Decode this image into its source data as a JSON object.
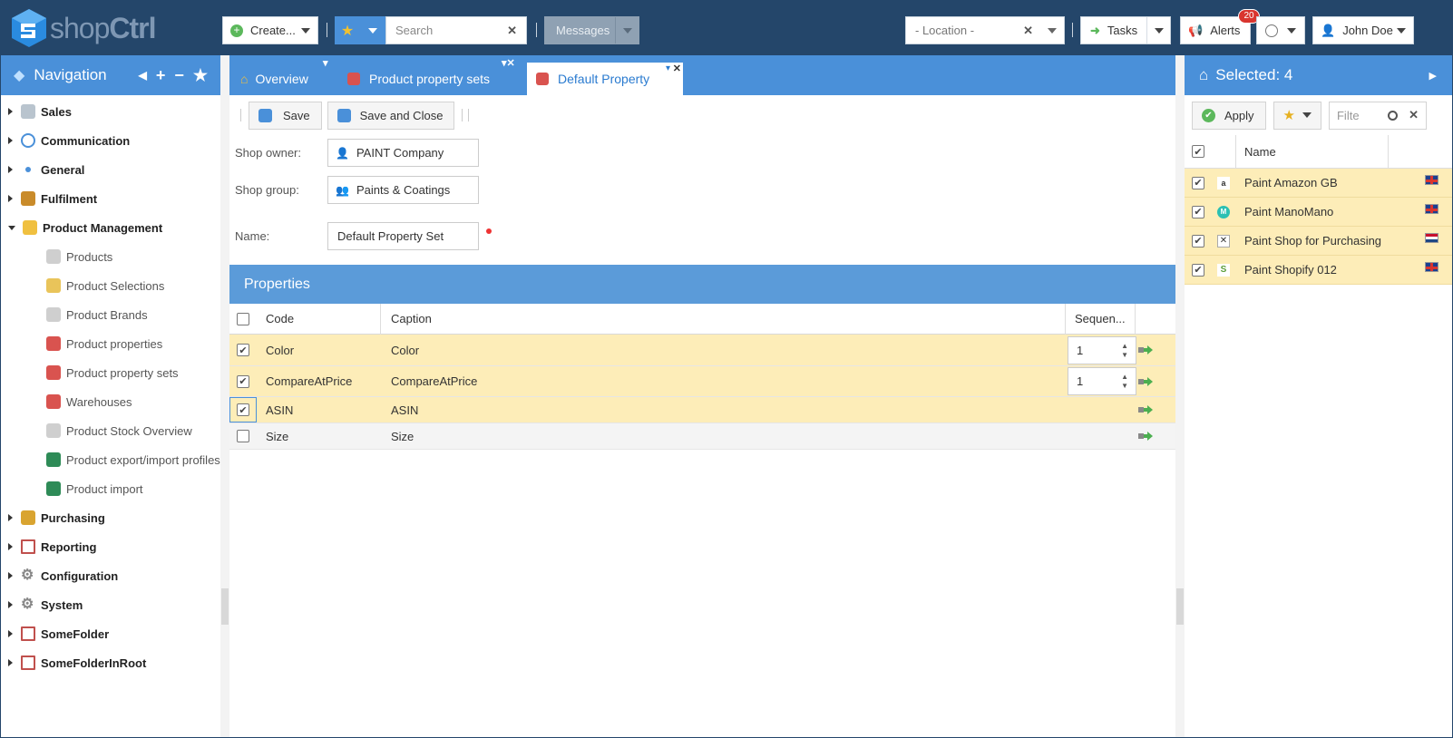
{
  "app": {
    "logo": "shopCtrl",
    "logo_prefix": "shop",
    "logo_suffix": "Ctrl"
  },
  "topbar": {
    "create_label": "Create...",
    "search_placeholder": "Search",
    "messages_label": "Messages",
    "location_placeholder": "- Location -",
    "tasks_label": "Tasks",
    "alerts_label": "Alerts",
    "alerts_count": "20",
    "user_name": "John Doe"
  },
  "nav": {
    "title": "Navigation",
    "items": [
      {
        "label": "Sales",
        "icon": "basket-icon",
        "color": "#8a9aa8"
      },
      {
        "label": "Communication",
        "icon": "chat-icon",
        "color": "#4a90d9"
      },
      {
        "label": "General",
        "icon": "dot-icon",
        "color": "#4a90d9"
      },
      {
        "label": "Fulfilment",
        "icon": "box-icon",
        "color": "#c98b2a"
      },
      {
        "label": "Product Management",
        "icon": "cube-icon",
        "color": "#e8b030",
        "open": true
      },
      {
        "label": "Purchasing",
        "icon": "cart-icon",
        "color": "#d9a430"
      },
      {
        "label": "Reporting",
        "icon": "report-icon",
        "color": "#c0504d"
      },
      {
        "label": "Configuration",
        "icon": "gear-icon",
        "color": "#888888"
      },
      {
        "label": "System",
        "icon": "gear-icon",
        "color": "#888888"
      },
      {
        "label": "SomeFolder",
        "icon": "folder-report-icon",
        "color": "#c0504d"
      },
      {
        "label": "SomeFolderInRoot",
        "icon": "folder-report-icon",
        "color": "#c0504d"
      }
    ],
    "sub_items": [
      {
        "label": "Products",
        "icon": "product-icon"
      },
      {
        "label": "Product Selections",
        "icon": "selection-icon"
      },
      {
        "label": "Product Brands",
        "icon": "brand-icon"
      },
      {
        "label": "Product properties",
        "icon": "properties-icon"
      },
      {
        "label": "Product property sets",
        "icon": "property-sets-icon"
      },
      {
        "label": "Warehouses",
        "icon": "warehouse-icon"
      },
      {
        "label": "Product Stock Overview",
        "icon": "stock-icon"
      },
      {
        "label": "Product export/import profiles",
        "icon": "excel-icon"
      },
      {
        "label": "Product import",
        "icon": "excel-icon"
      }
    ]
  },
  "tabs": [
    {
      "label": "Overview",
      "icon": "home-icon"
    },
    {
      "label": "Product property sets",
      "icon": "property-sets-icon"
    },
    {
      "label": "Default Property",
      "icon": "property-sets-icon",
      "active": true
    }
  ],
  "toolbar": {
    "save_label": "Save",
    "save_close_label": "Save and Close"
  },
  "form": {
    "shop_owner_label": "Shop owner:",
    "shop_owner_value": "PAINT Company",
    "shop_group_label": "Shop group:",
    "shop_group_value": "Paints & Coatings",
    "name_label": "Name:",
    "name_value": "Default Property Set"
  },
  "properties": {
    "title": "Properties",
    "columns": {
      "code": "Code",
      "caption": "Caption",
      "sequence": "Sequen..."
    },
    "rows": [
      {
        "code": "Color",
        "caption": "Color",
        "sequence": "1",
        "checked": true
      },
      {
        "code": "CompareAtPrice",
        "caption": "CompareAtPrice",
        "sequence": "1",
        "checked": true
      },
      {
        "code": "ASIN",
        "caption": "ASIN",
        "sequence": "",
        "checked": true
      },
      {
        "code": "Size",
        "caption": "Size",
        "sequence": "",
        "checked": false
      }
    ]
  },
  "selected_panel": {
    "title": "Selected: 4",
    "apply_label": "Apply",
    "filter_placeholder": "Filte",
    "name_column": "Name",
    "shops": [
      {
        "name": "Paint Amazon GB",
        "icon": "amazon-icon",
        "flag": "uk-flag"
      },
      {
        "name": "Paint ManoMano",
        "icon": "manomano-icon",
        "flag": "uk-flag"
      },
      {
        "name": "Paint Shop for Purchasing",
        "icon": "x-icon",
        "flag": "nl-flag"
      },
      {
        "name": "Paint Shopify 012",
        "icon": "shopify-icon",
        "flag": "uk-flag"
      }
    ]
  }
}
